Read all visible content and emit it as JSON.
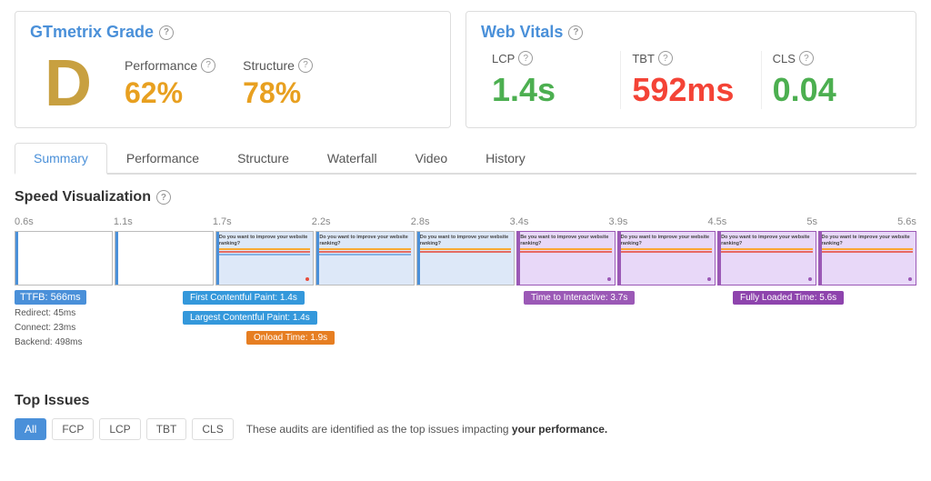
{
  "header": {
    "gtmetrix_title": "GTmetrix Grade",
    "webvitals_title": "Web Vitals",
    "help": "?"
  },
  "grade": {
    "letter": "D",
    "performance_label": "Performance",
    "performance_value": "62%",
    "structure_label": "Structure",
    "structure_value": "78%"
  },
  "vitals": {
    "lcp_label": "LCP",
    "lcp_value": "1.4s",
    "tbt_label": "TBT",
    "tbt_value": "592ms",
    "cls_label": "CLS",
    "cls_value": "0.04"
  },
  "tabs": {
    "items": [
      {
        "label": "Summary",
        "active": true
      },
      {
        "label": "Performance",
        "active": false
      },
      {
        "label": "Structure",
        "active": false
      },
      {
        "label": "Waterfall",
        "active": false
      },
      {
        "label": "Video",
        "active": false
      },
      {
        "label": "History",
        "active": false
      }
    ]
  },
  "speed_viz": {
    "title": "Speed Visualization",
    "ruler": [
      "0.6s",
      "1.1s",
      "1.7s",
      "2.2s",
      "2.8s",
      "3.4s",
      "3.9s",
      "4.5s",
      "5s",
      "5.6s"
    ],
    "ttfb": "TTFB: 566ms",
    "ttfb_sub": "Redirect: 45ms\nConnect: 23ms\nBackend: 498ms",
    "fcp": "First Contentful Paint: 1.4s",
    "lcp": "Largest Contentful Paint: 1.4s",
    "onload": "Onload Time: 1.9s",
    "tti": "Time to Interactive: 3.7s",
    "flt": "Fully Loaded Time: 5.6s",
    "screenshot_text": "Do you want to improve your website ranking?"
  },
  "top_issues": {
    "title": "Top Issues",
    "filters": [
      "All",
      "FCP",
      "LCP",
      "TBT",
      "CLS"
    ],
    "active_filter": "All",
    "note_text": "These audits are identified as the top issues impacting",
    "note_bold": "your performance."
  }
}
